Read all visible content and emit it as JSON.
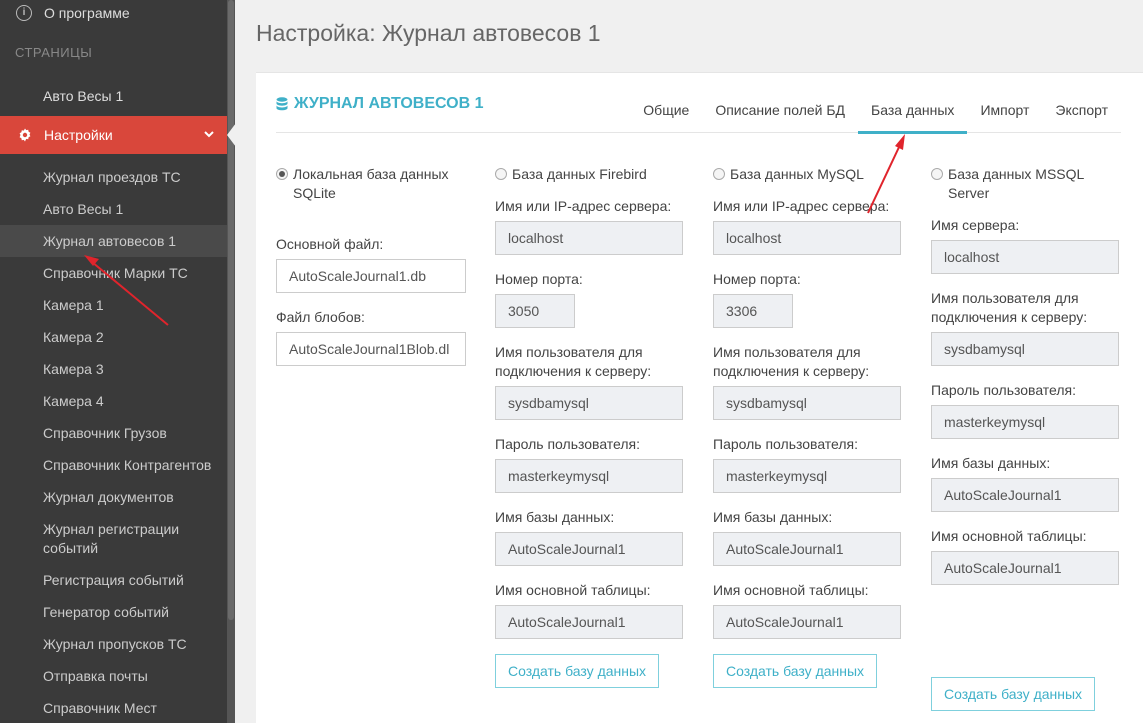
{
  "sidebar": {
    "about": "О программе",
    "section_pages": "СТРАНИЦЫ",
    "page_item": "Авто Весы 1",
    "active_item": "Настройки",
    "sub_items": [
      "Журнал проездов ТС",
      "Авто Весы 1",
      "Журнал автовесов 1",
      "Справочник Марки ТС",
      "Камера 1",
      "Камера 2",
      "Камера 3",
      "Камера 4",
      "Справочник Грузов",
      "Справочник Контрагентов",
      "Журнал документов",
      "Журнал регистрации событий",
      "Регистрация событий",
      "Генератор событий",
      "Журнал пропусков ТС",
      "Отправка почты",
      "Справочник Мест"
    ]
  },
  "page_title": "Настройка: Журнал автовесов 1",
  "card": {
    "title": "ЖУРНАЛ АВТОВЕСОВ 1",
    "tabs": [
      "Общие",
      "Описание полей БД",
      "База данных",
      "Импорт",
      "Экспорт"
    ],
    "active_tab": "База данных"
  },
  "sqlite": {
    "radio": "Локальная база данных SQLite",
    "main_file_label": "Основной файл:",
    "main_file": "AutoScaleJournal1.db",
    "blob_file_label": "Файл блобов:",
    "blob_file": "AutoScaleJournal1Blob.dl"
  },
  "firebird": {
    "radio": "База данных Firebird",
    "server_label": "Имя или IP-адрес сервера:",
    "server": "localhost",
    "port_label": "Номер порта:",
    "port": "3050",
    "user_label": "Имя пользователя для подключения к серверу:",
    "user": "sysdbamysql",
    "password_label": "Пароль пользователя:",
    "password": "masterkeymysql",
    "db_label": "Имя базы данных:",
    "db": "AutoScaleJournal1",
    "table_label": "Имя основной таблицы:",
    "table": "AutoScaleJournal1",
    "create_button": "Создать базу данных"
  },
  "mysql": {
    "radio": "База данных MySQL",
    "server_label": "Имя или IP-адрес сервера:",
    "server": "localhost",
    "port_label": "Номер порта:",
    "port": "3306",
    "user_label": "Имя пользователя для подключения к серверу:",
    "user": "sysdbamysql",
    "password_label": "Пароль пользователя:",
    "password": "masterkeymysql",
    "db_label": "Имя базы данных:",
    "db": "AutoScaleJournal1",
    "table_label": "Имя основной таблицы:",
    "table": "AutoScaleJournal1",
    "create_button": "Создать базу данных"
  },
  "mssql": {
    "radio": "База данных MSSQL Server",
    "server_label": "Имя сервера:",
    "server": "localhost",
    "user_label": "Имя пользователя для подключения к серверу:",
    "user": "sysdbamysql",
    "password_label": "Пароль пользователя:",
    "password": "masterkeymysql",
    "db_label": "Имя базы данных:",
    "db": "AutoScaleJournal1",
    "table_label": "Имя основной таблицы:",
    "table": "AutoScaleJournal1",
    "create_button": "Создать базу данных"
  },
  "colors": {
    "sidebar_bg": "#3a3a3a",
    "active_bg": "#d9473b",
    "accent": "#3fb0c8",
    "annotation_arrow": "#e0242c"
  }
}
